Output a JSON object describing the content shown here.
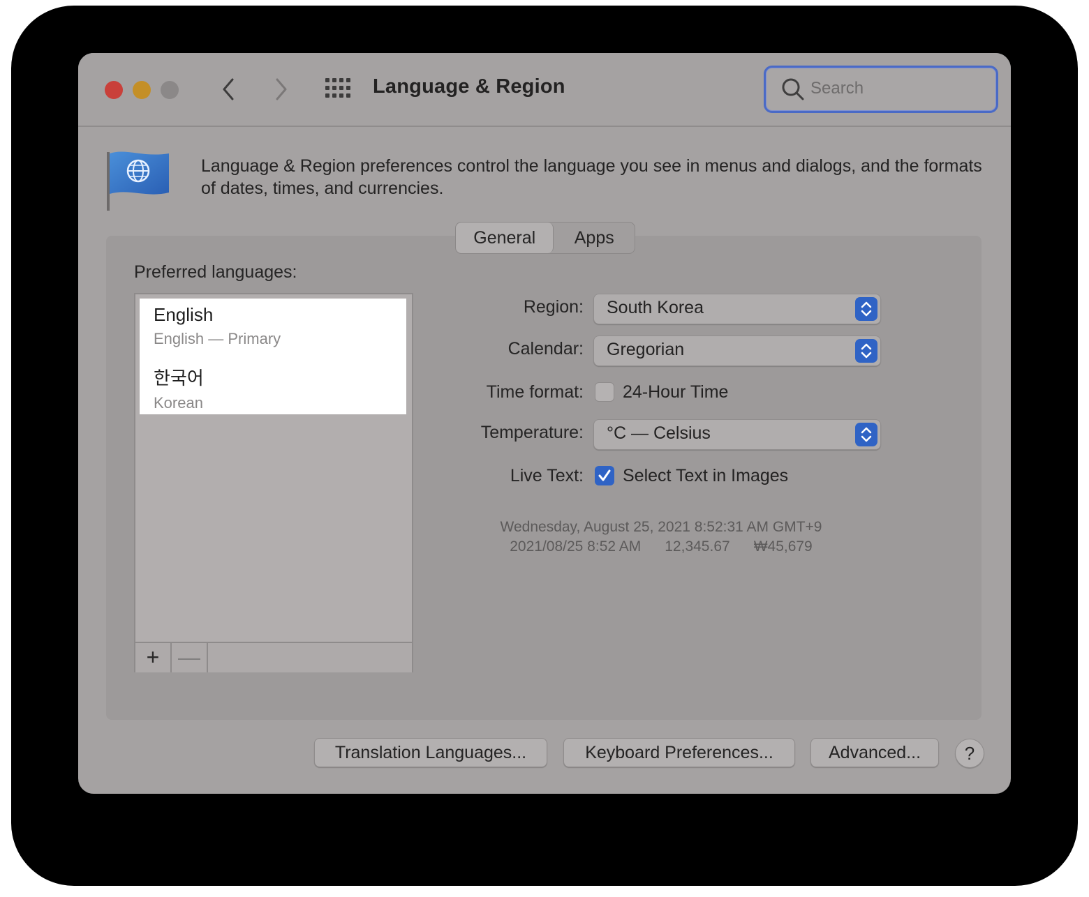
{
  "window": {
    "title": "Language & Region"
  },
  "search": {
    "placeholder": "Search"
  },
  "description": "Language & Region preferences control the language you see in menus and dialogs, and the formats of dates, times, and currencies.",
  "tabs": [
    {
      "label": "General",
      "selected": true
    },
    {
      "label": "Apps",
      "selected": false
    }
  ],
  "preferred_languages": {
    "label": "Preferred languages:",
    "items": [
      {
        "name": "English",
        "subtitle": "English — Primary"
      },
      {
        "name": "한국어",
        "subtitle": "Korean"
      }
    ],
    "add_label": "+",
    "remove_label": "—"
  },
  "settings": {
    "region": {
      "label": "Region:",
      "value": "South Korea"
    },
    "calendar": {
      "label": "Calendar:",
      "value": "Gregorian"
    },
    "time_format": {
      "label": "Time format:",
      "option": "24-Hour Time",
      "checked": false
    },
    "temperature": {
      "label": "Temperature:",
      "value": "°C — Celsius"
    },
    "live_text": {
      "label": "Live Text:",
      "option": "Select Text in Images",
      "checked": true
    }
  },
  "sample": {
    "date_long": "Wednesday, August 25, 2021 8:52:31 AM GMT+9",
    "date_short": "2021/08/25 8:52 AM",
    "number": "12,345.67",
    "currency": "₩45,679"
  },
  "buttons": {
    "translation": "Translation Languages...",
    "keyboard": "Keyboard Preferences...",
    "advanced": "Advanced...",
    "help": "?"
  },
  "colors": {
    "window_bg": "#a5a2a2",
    "accent": "#2f63c5",
    "close": "#c9403a",
    "minimize": "#c48f27",
    "zoom": "#8b8888"
  }
}
